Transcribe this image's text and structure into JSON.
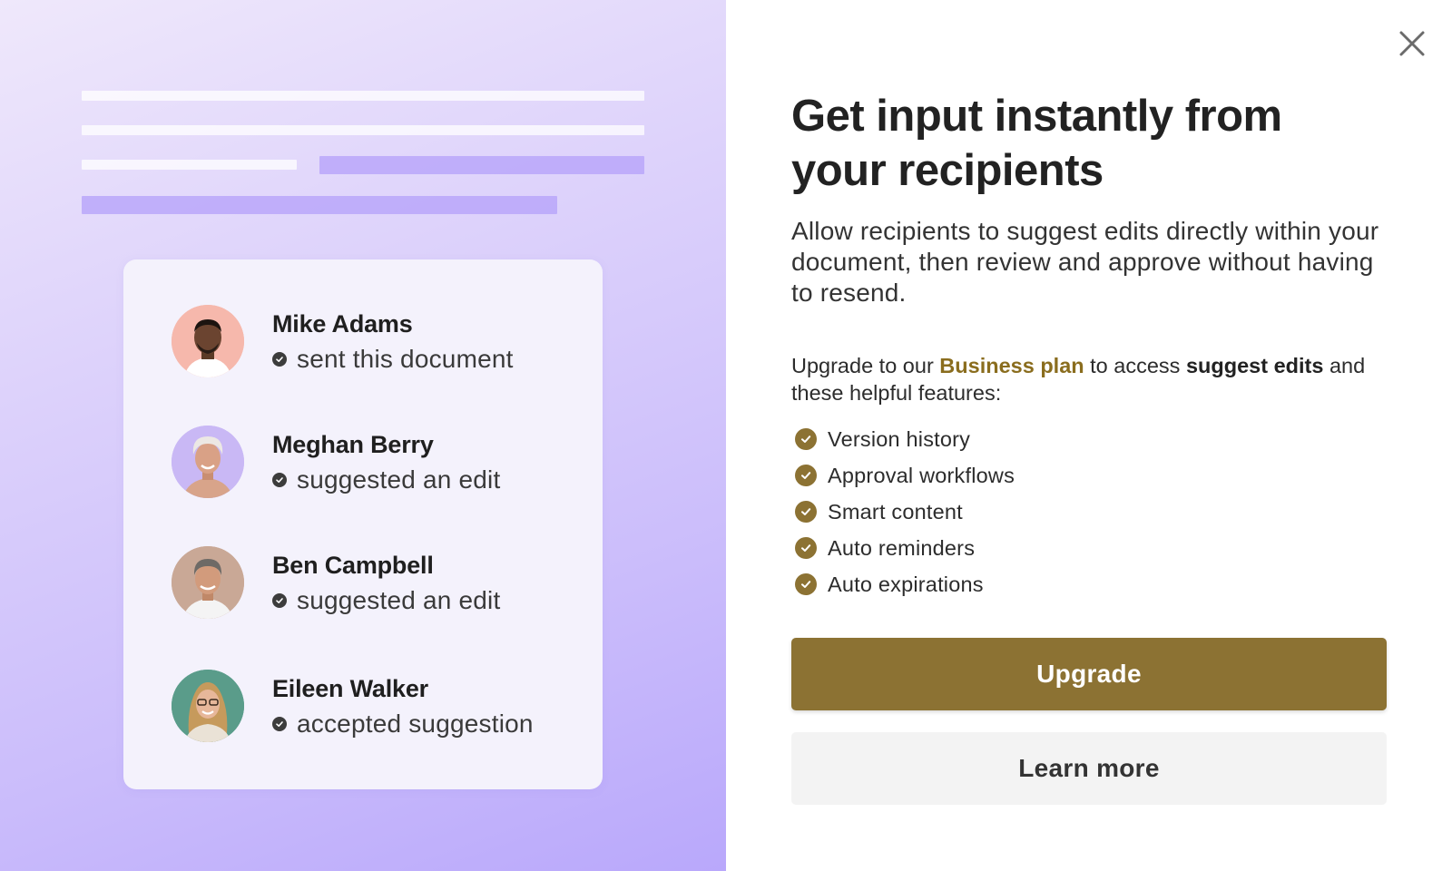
{
  "dialog": {
    "heading": "Get input instantly from your recipients",
    "description": "Allow recipients to suggest edits directly within your document, then review and approve without having to resend.",
    "upgrade_prefix": "Upgrade to our ",
    "plan_name": "Business plan",
    "upgrade_middle": " to access ",
    "feature_name": "suggest edits",
    "upgrade_suffix": " and these helpful features:",
    "features": [
      {
        "label": "Version history"
      },
      {
        "label": "Approval workflows"
      },
      {
        "label": "Smart content"
      },
      {
        "label": "Auto reminders"
      },
      {
        "label": "Auto expirations"
      }
    ],
    "primary_button": "Upgrade",
    "secondary_button": "Learn more",
    "close_icon": "close-icon"
  },
  "illustration": {
    "activity": [
      {
        "name": "Mike Adams",
        "action": "sent this document",
        "avatar_bg": "#f6b8ac"
      },
      {
        "name": "Meghan Berry",
        "action": "suggested an edit",
        "avatar_bg": "#c9b8f5"
      },
      {
        "name": "Ben Campbell",
        "action": "suggested an edit",
        "avatar_bg": "#c9a896"
      },
      {
        "name": "Eileen Walker",
        "action": "accepted suggestion",
        "avatar_bg": "#5a9c8a"
      }
    ]
  },
  "colors": {
    "accent": "#8c7233",
    "plan_link": "#8a6d1e",
    "secondary_button_bg": "#f3f3f3",
    "panel_gradient_start": "#efe8fb",
    "panel_gradient_end": "#b9a8fb"
  }
}
